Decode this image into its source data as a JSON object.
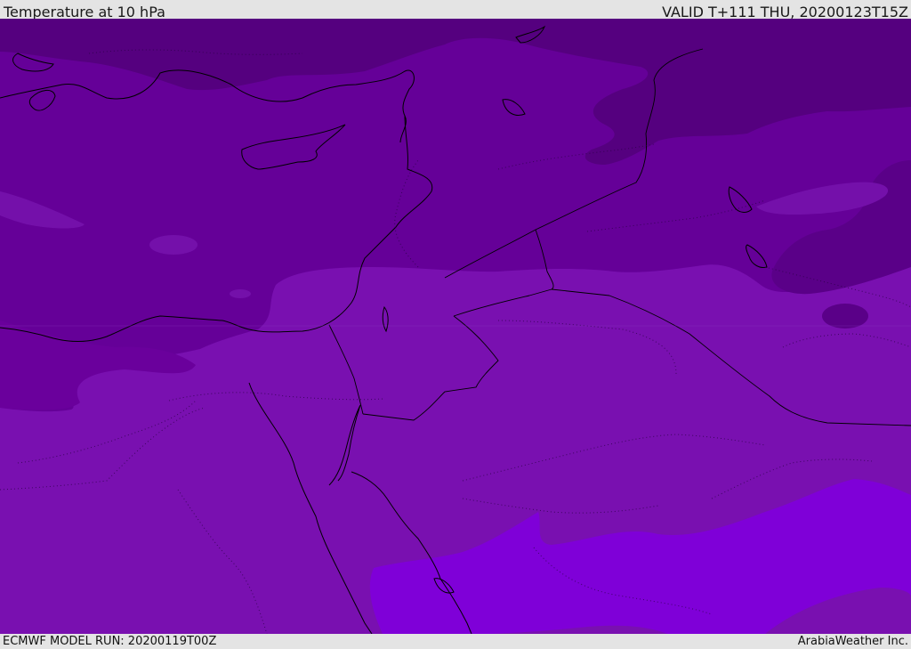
{
  "header": {
    "title": "Temperature at 10 hPa",
    "valid_time": "VALID T+111 THU, 20200123T15Z"
  },
  "footer": {
    "model_run": "ECMWF MODEL RUN: 20200119T00Z",
    "credit": "ArabiaWeather Inc."
  },
  "map": {
    "field": "temperature",
    "level": "10 hPa",
    "colors": {
      "darkest": "#52007f",
      "dark": "#600090",
      "mid": "#6c00a0",
      "light": "#7910b0",
      "bright": "#7f00d8",
      "coastline": "#000000"
    },
    "features": {
      "coastline": "coastline-paths",
      "borders": "country-borders",
      "contours": "dotted-contour-lines"
    }
  }
}
